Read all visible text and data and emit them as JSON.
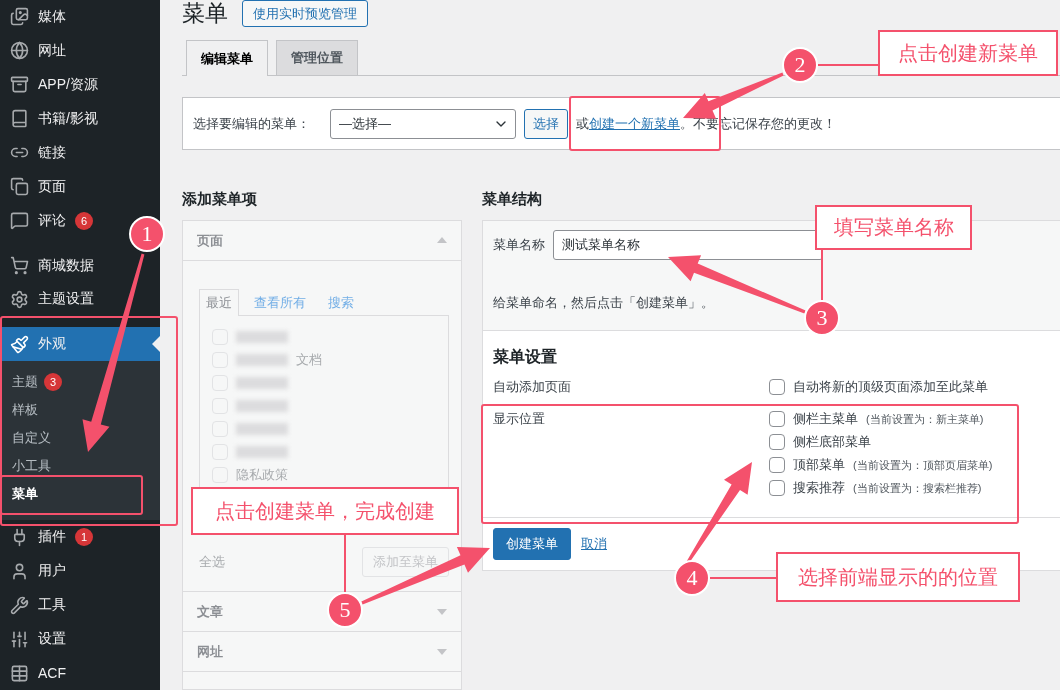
{
  "sidebar": {
    "items": [
      {
        "label": "媒体",
        "selected": false
      },
      {
        "label": "网址",
        "selected": false
      },
      {
        "label": "APP/资源",
        "selected": false
      },
      {
        "label": "书籍/影视",
        "selected": false
      },
      {
        "label": "链接",
        "selected": false
      },
      {
        "label": "页面",
        "selected": false
      },
      {
        "label": "评论",
        "badge": "6",
        "selected": false
      },
      {
        "label": "商城数据",
        "selected": false
      },
      {
        "label": "主题设置",
        "selected": false
      },
      {
        "label": "外观",
        "selected": true,
        "submenu": [
          {
            "label": "主题",
            "badge": "3",
            "selected": false
          },
          {
            "label": "样板",
            "selected": false
          },
          {
            "label": "自定义",
            "selected": false
          },
          {
            "label": "小工具",
            "selected": false
          },
          {
            "label": "菜单",
            "selected": true
          }
        ]
      },
      {
        "label": "插件",
        "badge": "1",
        "selected": false
      },
      {
        "label": "用户",
        "selected": false
      },
      {
        "label": "工具",
        "selected": false
      },
      {
        "label": "设置",
        "selected": false
      },
      {
        "label": "ACF",
        "selected": false
      }
    ]
  },
  "page": {
    "title": "菜单",
    "preview_button": "使用实时预览管理",
    "tabs": [
      {
        "label": "编辑菜单",
        "selected": true
      },
      {
        "label": "管理位置",
        "selected": false
      }
    ],
    "select_bar": {
      "label": "选择要编辑的菜单：",
      "select_value": "—选择—",
      "select_button": "选择",
      "text_before": "或",
      "link": "创建一个新菜单",
      "text_after": "。不要忘记保存您的更改！"
    }
  },
  "add_items": {
    "heading": "添加菜单项",
    "sections": [
      {
        "title": "页面",
        "expanded": true
      },
      {
        "title": "文章",
        "expanded": false
      },
      {
        "title": "网址",
        "expanded": false
      }
    ],
    "page_tabs": [
      {
        "label": "最近",
        "selected": true
      },
      {
        "label": "查看所有",
        "selected": false
      },
      {
        "label": "搜索",
        "selected": false
      }
    ],
    "pages": [
      {
        "kind": "blurred",
        "checked": false
      },
      {
        "kind": "blurred",
        "text": "文档",
        "checked": false
      },
      {
        "kind": "blurred",
        "checked": false
      },
      {
        "kind": "blurred",
        "checked": false
      },
      {
        "kind": "blurred",
        "checked": false
      },
      {
        "kind": "blurred",
        "checked": false
      },
      {
        "kind": "plain",
        "text": "隐私政策",
        "checked": false
      }
    ],
    "select_all": "全选",
    "add_button": "添加至菜单"
  },
  "structure": {
    "heading": "菜单结构",
    "name_label": "菜单名称",
    "name_value": "测试菜单名称",
    "help": "给菜单命名，然后点击「创建菜单」。",
    "settings_heading": "菜单设置",
    "auto_add": {
      "label": "自动添加页面",
      "options": [
        {
          "label": "自动将新的顶级页面添加至此菜单",
          "checked": false
        }
      ]
    },
    "locations": {
      "label": "显示位置",
      "options": [
        {
          "label": "侧栏主菜单",
          "note": "(当前设置为：新主菜单)",
          "checked": false
        },
        {
          "label": "侧栏底部菜单",
          "checked": false
        },
        {
          "label": "顶部菜单",
          "note": "(当前设置为：顶部页眉菜单)",
          "checked": false
        },
        {
          "label": "搜索推荐",
          "note": "(当前设置为：搜索栏推荐)",
          "checked": false
        }
      ]
    },
    "create_button": "创建菜单",
    "cancel_link": "取消"
  },
  "annotations": [
    {
      "number": "1"
    },
    {
      "number": "2",
      "text": "点击创建新菜单"
    },
    {
      "number": "3",
      "text": "填写菜单名称"
    },
    {
      "number": "4",
      "text": "选择前端显示的的位置"
    },
    {
      "number": "5",
      "text": "点击创建菜单，完成创建"
    }
  ]
}
